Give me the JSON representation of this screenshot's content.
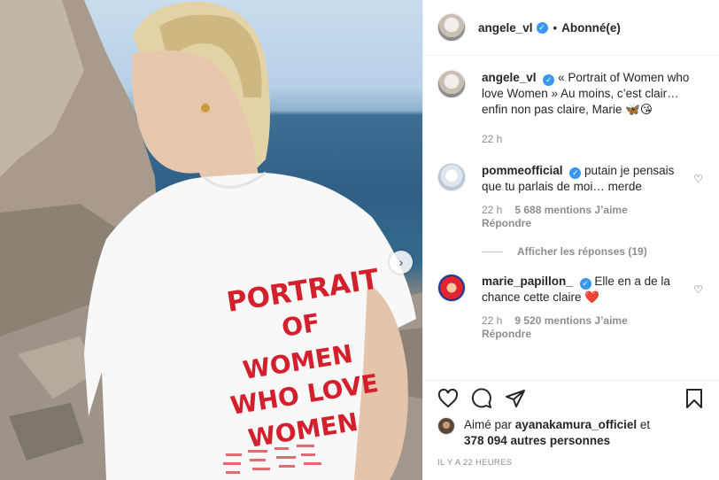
{
  "post": {
    "author": "angele_vl",
    "follow_state": "Abonné(e)",
    "separator": "•"
  },
  "caption": {
    "username": "angele_vl",
    "text": "« Portrait of Women who love Women » Au moins, c’est clair… enfin non pas claire, Marie 🦋😘",
    "time": "22 h"
  },
  "comments": [
    {
      "username": "pommeofficial",
      "text": "putain je pensais que tu parlais de moi… merde",
      "time": "22 h",
      "likes": "5 688 mentions J’aime",
      "reply": "Répondre"
    },
    {
      "username": "marie_papillon_",
      "text": "Elle en a de la chance cette claire ❤️",
      "time": "22 h",
      "likes": "9 520 mentions J’aime",
      "reply": "Répondre"
    }
  ],
  "show_replies": "Afficher les réponses (19)",
  "liked_by": {
    "prefix": "Aimé par",
    "user": "ayanakamura_officiel",
    "suffix": "et",
    "others": "378 094 autres personnes"
  },
  "timestamp": "IL Y A 22 HEURES",
  "photo": {
    "shirt_text": [
      "PORTRAIT",
      "OF",
      "WOMEN",
      "WHO LOVE",
      "WOMEN"
    ]
  },
  "colors": {
    "verified": "#3897f0",
    "shirt_print": "#d4202c",
    "meta": "#8e8e8e"
  },
  "icons": [
    "verified-icon",
    "heart-icon",
    "comment-icon",
    "share-icon",
    "bookmark-icon",
    "chevron-right-icon"
  ]
}
